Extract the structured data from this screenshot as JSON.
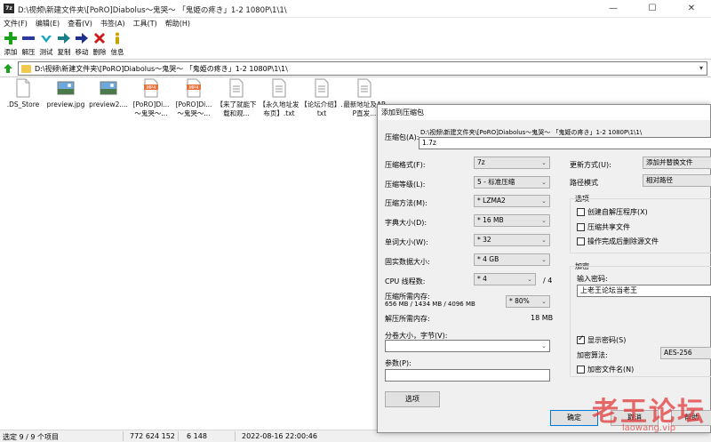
{
  "window": {
    "title": "D:\\视频\\新建文件夹\\[PoRO]Diabolus～鬼哭～ 「鬼姫の疼き」1-2 1080P\\1\\1\\",
    "app_icon_text": "7z",
    "minimize": "—",
    "maximize": "☐",
    "close": "✕"
  },
  "menu": [
    "文件(F)",
    "编辑(E)",
    "查看(V)",
    "书签(A)",
    "工具(T)",
    "帮助(H)"
  ],
  "toolbar": [
    {
      "label": "添加",
      "icon": "add-icon",
      "color": "#1aa31a"
    },
    {
      "label": "解压",
      "icon": "extract-icon",
      "color": "#2a3b9c"
    },
    {
      "label": "测试",
      "icon": "test-icon",
      "color": "#14a8b8"
    },
    {
      "label": "复制",
      "icon": "copy-icon",
      "color": "#1a7f8a"
    },
    {
      "label": "移动",
      "icon": "move-icon",
      "color": "#1f2f8a"
    },
    {
      "label": "删除",
      "icon": "delete-icon",
      "color": "#d01818"
    },
    {
      "label": "信息",
      "icon": "info-icon",
      "color": "#c9a400"
    }
  ],
  "address": "D:\\视频\\新建文件夹\\[PoRO]Diabolus～鬼哭～ 「鬼姫の疼き」1-2 1080P\\1\\1\\",
  "files": [
    {
      "name": ".DS_Store",
      "type": "doc"
    },
    {
      "name": "preview.jpg",
      "type": "img"
    },
    {
      "name": "preview2....",
      "type": "img"
    },
    {
      "name": "[PoRO]Di... ～鬼哭～...",
      "type": "mp4"
    },
    {
      "name": "[PoRO]Di... ～鬼哭～...",
      "type": "mp4"
    },
    {
      "name": "【来了就能下载和观...",
      "type": "doc"
    },
    {
      "name": "【永久地址发布页】.txt",
      "type": "doc"
    },
    {
      "name": "【论坛介绍】.txt",
      "type": "doc"
    },
    {
      "name": "最新地址及APP直发...",
      "type": "doc"
    }
  ],
  "status": {
    "selected": "选定 9 / 9 个项目",
    "size": "772 624 152",
    "packed": "6 148",
    "date": "2022-08-16 22:00:46"
  },
  "dialog": {
    "title": "添加到压缩包",
    "archive_label": "压缩包(A):",
    "archive_path": "D:\\视频\\新建文件夹\\[PoRO]Diabolus～鬼哭～ 「鬼姫の疼き」1-2 1080P\\1\\1\\",
    "archive_name": "1.7z",
    "format_label": "压缩格式(F):",
    "format_value": "7z",
    "level_label": "压缩等级(L):",
    "level_value": "5 - 标准压缩",
    "method_label": "压缩方法(M):",
    "method_value": "* LZMA2",
    "dict_label": "字典大小(D):",
    "dict_value": "* 16 MB",
    "word_label": "单词大小(W):",
    "word_value": "* 32",
    "solid_label": "固实数据大小:",
    "solid_value": "* 4 GB",
    "cpu_label": "CPU 线程数:",
    "cpu_value": "* 4",
    "cpu_max": "/ 4",
    "mem_label": "压缩所需内存:",
    "mem_value": "656 MB / 1434 MB / 4096 MB",
    "mem_pct": "* 80%",
    "demem_label": "解压所需内存:",
    "demem_value": "18 MB",
    "split_label": "分卷大小，字节(V):",
    "params_label": "参数(P):",
    "options_button": "选项",
    "update_label": "更新方式(U):",
    "update_value": "添加并替换文件",
    "path_label": "路径模式",
    "path_value": "相对路径",
    "options_group": "选项",
    "opt_sfx": "创建自解压程序(X)",
    "opt_shared": "压缩共享文件",
    "opt_delete": "操作完成后删除源文件",
    "enc_group": "加密",
    "pwd_label": "输入密码:",
    "pwd_value": "上老王论坛当老王",
    "show_pwd": "显示密码(S)",
    "enc_method_label": "加密算法:",
    "enc_method_value": "AES-256",
    "enc_names": "加密文件名(N)",
    "ok": "确定",
    "cancel": "取消",
    "help": "帮助"
  },
  "watermark": {
    "main": "老王论坛",
    "sub": "laowang.vip"
  }
}
